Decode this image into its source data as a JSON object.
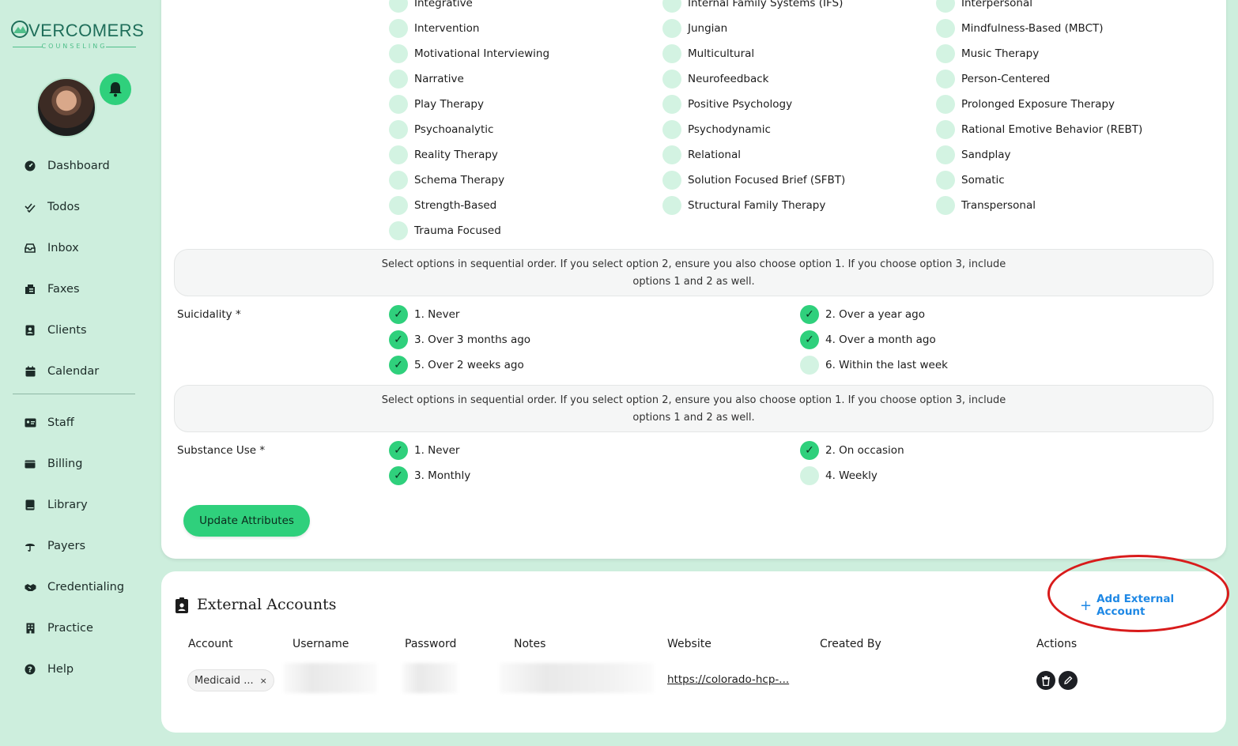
{
  "brand": {
    "name": "VERCOMERS",
    "sub": "COUNSELING"
  },
  "nav": {
    "items": [
      {
        "label": "Dashboard",
        "icon": "dashboard-icon"
      },
      {
        "label": "Todos",
        "icon": "double-check-icon"
      },
      {
        "label": "Inbox",
        "icon": "inbox-icon"
      },
      {
        "label": "Faxes",
        "icon": "fax-icon"
      },
      {
        "label": "Clients",
        "icon": "contact-card-icon"
      },
      {
        "label": "Calendar",
        "icon": "calendar-icon"
      },
      {
        "label": "Staff",
        "icon": "id-card-icon"
      },
      {
        "label": "Billing",
        "icon": "wallet-icon"
      },
      {
        "label": "Library",
        "icon": "book-icon"
      },
      {
        "label": "Payers",
        "icon": "umbrella-icon"
      },
      {
        "label": "Credentialing",
        "icon": "handshake-icon"
      },
      {
        "label": "Practice",
        "icon": "building-icon"
      },
      {
        "label": "Help",
        "icon": "question-icon"
      }
    ]
  },
  "modalities": {
    "col1": [
      "Integrative",
      "Intervention",
      "Motivational Interviewing",
      "Narrative",
      "Play Therapy",
      "Psychoanalytic",
      "Reality Therapy",
      "Schema Therapy",
      "Strength-Based",
      "Trauma Focused"
    ],
    "col2": [
      "Internal Family Systems (IFS)",
      "Jungian",
      "Multicultural",
      "Neurofeedback",
      "Positive Psychology",
      "Psychodynamic",
      "Relational",
      "Solution Focused Brief (SFBT)",
      "Structural Family Therapy"
    ],
    "col3": [
      "Interpersonal",
      "Mindfulness-Based (MBCT)",
      "Music Therapy",
      "Person-Centered",
      "Prolonged Exposure Therapy",
      "Rational Emotive Behavior (REBT)",
      "Sandplay",
      "Somatic",
      "Transpersonal"
    ]
  },
  "note_suicidality": "Select options in sequential order. If you select option 2, ensure you also choose option 1. If you choose option 3, include options 1 and 2 as well.",
  "suicidality": {
    "label": "Suicidality *",
    "options": [
      {
        "label": "1. Never",
        "checked": true
      },
      {
        "label": "2. Over a year ago",
        "checked": true
      },
      {
        "label": "3. Over 3 months ago",
        "checked": true
      },
      {
        "label": "4. Over a month ago",
        "checked": true
      },
      {
        "label": "5. Over 2 weeks ago",
        "checked": true
      },
      {
        "label": "6. Within the last week",
        "checked": false
      }
    ]
  },
  "note_substance": "Select options in sequential order. If you select option 2, ensure you also choose option 1. If you choose option 3, include options 1 and 2 as well.",
  "substance": {
    "label": "Substance Use *",
    "options": [
      {
        "label": "1. Never",
        "checked": true
      },
      {
        "label": "2. On occasion",
        "checked": true
      },
      {
        "label": "3. Monthly",
        "checked": true
      },
      {
        "label": "4. Weekly",
        "checked": false
      }
    ]
  },
  "update_button": "Update Attributes",
  "external": {
    "title": "External Accounts",
    "add_label": "Add External Account",
    "columns": [
      "Account",
      "Username",
      "Password",
      "Notes",
      "Website",
      "Created By",
      "Actions"
    ],
    "row": {
      "account": "Medicaid ...",
      "remove": "×",
      "website": "https://colorado-hcp-..."
    }
  },
  "colors": {
    "accent": "#2fd07c",
    "background": "#cdeedd",
    "link": "#1e88e5",
    "highlight": "#d81b1b"
  }
}
